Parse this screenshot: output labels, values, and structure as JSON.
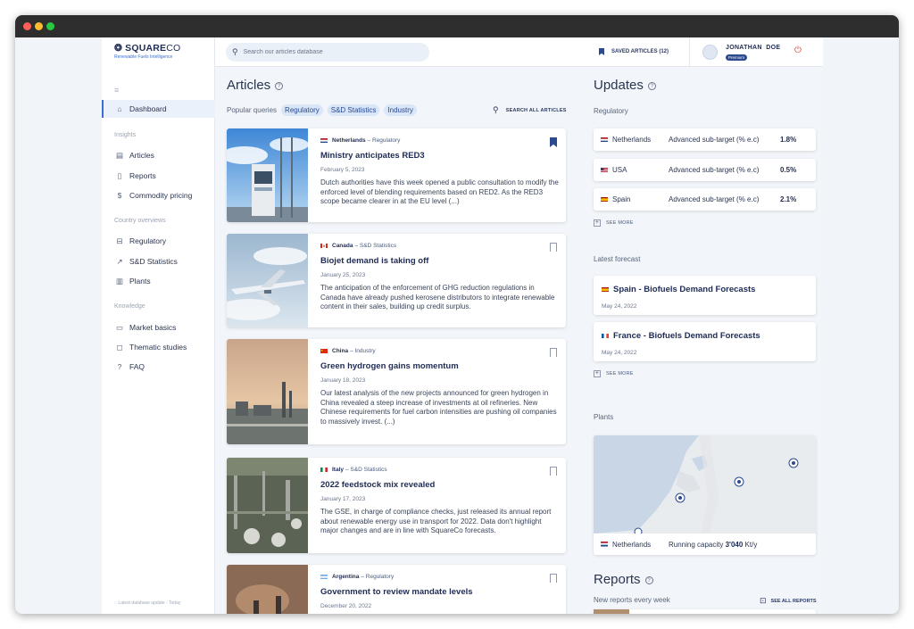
{
  "brand": {
    "name_a": "SQUARE",
    "name_b": "CO",
    "tagline": "Renewable Fuels Intelligence"
  },
  "topbar": {
    "search_placeholder": "Search our articles database",
    "saved_label": "SAVED ARTICLES (12)",
    "user_name": "JONATHAN  DOE",
    "user_badge": "Premium"
  },
  "sidebar": {
    "dashboard": "Dashboard",
    "insights_label": "Insights",
    "insights": [
      "Articles",
      "Reports",
      "Commodity pricing"
    ],
    "country_label": "Country overviews",
    "country": [
      "Regulatory",
      "S&D Statistics",
      "Plants"
    ],
    "knowledge_label": "Knowledge",
    "knowledge": [
      "Market basics",
      "Thematic studies",
      "FAQ"
    ],
    "db_update": "Latest database update - Today"
  },
  "articles": {
    "title": "Articles",
    "popular_label": "Popular queries",
    "chips": [
      "Regulatory",
      "S&D Statistics",
      "Industry"
    ],
    "search_all": "SEARCH ALL ARTICLES",
    "items": [
      {
        "country": "Netherlands",
        "category": "– Regulatory",
        "title": "Ministry anticipates RED3",
        "date": "February 5, 2023",
        "excerpt": "Dutch authorities have this week opened a public consultation to modify the enforced level of blending requirements based on RED2. As the RED3 scope became clearer in at the EU level (...)",
        "saved": true
      },
      {
        "country": "Canada",
        "category": "– S&D Statistics",
        "title": "Biojet demand is taking off",
        "date": "January 25, 2023",
        "excerpt": "The anticipation of the enforcement of GHG reduction regulations in Canada have already pushed kerosene distributors to integrate renewable content in their sales, building up credit surplus.",
        "saved": false
      },
      {
        "country": "China",
        "category": "– Industry",
        "title": "Green hydrogen gains momentum",
        "date": "January 18, 2023",
        "excerpt": "Our latest analysis of the new projects announced for green hydrogen in China revealed a steep increase of investments at oil refineries. New Chinese requirements for fuel carbon intensities are pushing oil companies to massively invest. (...)",
        "saved": false
      },
      {
        "country": "Italy",
        "category": "– S&D Statistics",
        "title": "2022 feedstock mix revealed",
        "date": "January 17, 2023",
        "excerpt": "The GSE, in charge of compliance checks, just released its annual report about renewable energy use in transport for 2022. Data don't highlight major changes and are in line with SquareCo forecasts.",
        "saved": false
      },
      {
        "country": "Argentina",
        "category": "– Regulatory",
        "title": "Government to review mandate levels",
        "date": "December 20, 2022",
        "excerpt": "",
        "saved": false
      }
    ]
  },
  "updates": {
    "title": "Updates",
    "regulatory_label": "Regulatory",
    "regulatory": [
      {
        "country": "Netherlands",
        "metric": "Advanced sub-target (% e.c)",
        "value": "1.8%"
      },
      {
        "country": "USA",
        "metric": "Advanced sub-target (% e.c)",
        "value": "0.5%"
      },
      {
        "country": "Spain",
        "metric": "Advanced sub-target (% e.c)",
        "value": "2.1%"
      }
    ],
    "see_more": "SEE MORE",
    "forecast_label": "Latest forecast",
    "forecasts": [
      {
        "title": "Spain - Biofuels Demand Forecasts",
        "date": "May 24, 2022"
      },
      {
        "title": "France - Biofuels Demand Forecasts",
        "date": "May 24, 2022"
      }
    ],
    "plants_label": "Plants",
    "plants": {
      "country": "Netherlands",
      "capacity_label": "Running capacity",
      "capacity_value": "3'040",
      "unit": "Kt/y"
    }
  },
  "reports": {
    "title": "Reports",
    "subtitle": "New reports every week",
    "see_all": "SEE ALL REPORTS"
  },
  "colors": {
    "accent": "#2b4a8f",
    "chip_bg": "#d9e6f7",
    "logout": "#e0403a"
  }
}
